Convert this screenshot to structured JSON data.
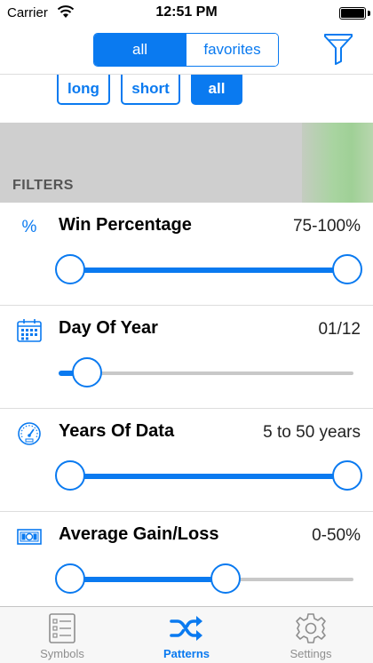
{
  "status": {
    "carrier": "Carrier",
    "time": "12:51 PM"
  },
  "nav": {
    "segments": [
      {
        "label": "all",
        "active": true
      },
      {
        "label": "favorites",
        "active": false
      }
    ],
    "filter_icon": "funnel-icon"
  },
  "type_buttons": [
    {
      "label": "long",
      "active": false
    },
    {
      "label": "short",
      "active": false
    },
    {
      "label": "all",
      "active": true
    }
  ],
  "section_header": "FILTERS",
  "filters": [
    {
      "title": "Win Percentage",
      "value": "75-100%",
      "icon": "percent-icon",
      "icon_text": "%",
      "range": [
        0,
        1
      ]
    },
    {
      "title": "Day Of Year",
      "value": "01/12",
      "icon": "calendar-icon",
      "range": [
        0,
        0.06
      ]
    },
    {
      "title": "Years Of Data",
      "value": "5 to 50 years",
      "icon": "gauge-icon",
      "range": [
        0,
        1
      ]
    },
    {
      "title": "Average Gain/Loss",
      "value": "0-50%",
      "icon": "money-icon",
      "range": [
        0,
        0.56
      ]
    }
  ],
  "tabs": [
    {
      "label": "Symbols",
      "icon": "list-icon",
      "active": false
    },
    {
      "label": "Patterns",
      "icon": "shuffle-icon",
      "active": true
    },
    {
      "label": "Settings",
      "icon": "gear-icon",
      "active": false
    }
  ],
  "colors": {
    "accent": "#0a7af0",
    "inactive": "#8e8e8e",
    "track": "#c8c8c8"
  }
}
